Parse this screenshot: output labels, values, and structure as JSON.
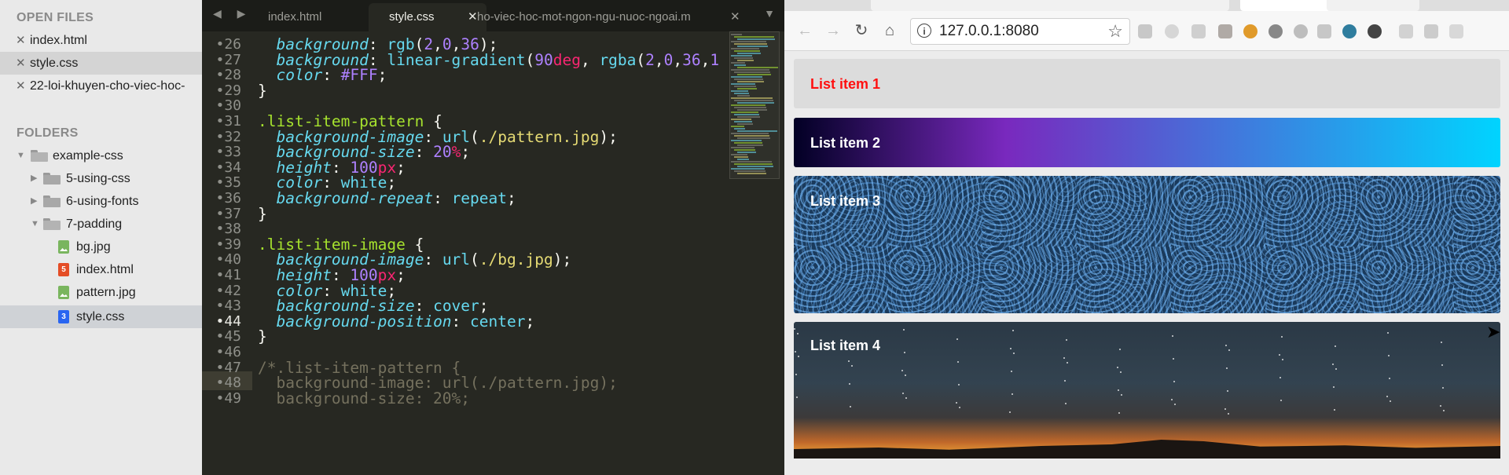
{
  "sidebar": {
    "open_files_heading": "OPEN FILES",
    "open_files": [
      {
        "name": "index.html",
        "active": false
      },
      {
        "name": "style.css",
        "active": true
      },
      {
        "name": "22-loi-khuyen-cho-viec-hoc-",
        "active": false
      }
    ],
    "folders_heading": "FOLDERS",
    "tree": [
      {
        "label": "example-css",
        "kind": "folder-open"
      },
      {
        "label": "5-using-css",
        "kind": "folder"
      },
      {
        "label": "6-using-fonts",
        "kind": "folder"
      },
      {
        "label": "7-padding",
        "kind": "folder-open"
      },
      {
        "label": "bg.jpg",
        "kind": "image"
      },
      {
        "label": "index.html",
        "kind": "html",
        "badge": "5"
      },
      {
        "label": "pattern.jpg",
        "kind": "image"
      },
      {
        "label": "style.css",
        "kind": "css",
        "badge": "3",
        "active": true
      }
    ]
  },
  "editor": {
    "tabs": [
      {
        "label": "index.html",
        "active": false
      },
      {
        "label": "style.css",
        "active": true
      },
      {
        "label": "ho-viec-hoc-mot-ngon-ngu-nuoc-ngoai.m",
        "active": false
      }
    ],
    "nav_arrows": "◀ ▶",
    "dropdown": "▼",
    "line_numbers": [
      "26",
      "27",
      "28",
      "29",
      "30",
      "31",
      "32",
      "33",
      "34",
      "35",
      "36",
      "37",
      "38",
      "39",
      "40",
      "41",
      "42",
      "43",
      "44",
      "45",
      "46",
      "47",
      "48",
      "49"
    ],
    "current_line": "44",
    "lines": [
      [
        [
          "p",
          "background"
        ],
        [
          "t",
          ": "
        ],
        [
          "v",
          "rgb"
        ],
        [
          "t",
          "("
        ],
        [
          "n",
          "2"
        ],
        [
          "t",
          ","
        ],
        [
          "n",
          "0"
        ],
        [
          "t",
          ","
        ],
        [
          "n",
          "36"
        ],
        [
          "t",
          ");"
        ]
      ],
      [
        [
          "p",
          "background"
        ],
        [
          "t",
          ": "
        ],
        [
          "v",
          "linear-gradient"
        ],
        [
          "t",
          "("
        ],
        [
          "n",
          "90"
        ],
        [
          "u",
          "deg"
        ],
        [
          "t",
          ", "
        ],
        [
          "v",
          "rgba"
        ],
        [
          "t",
          "("
        ],
        [
          "n",
          "2"
        ],
        [
          "t",
          ","
        ],
        [
          "n",
          "0"
        ],
        [
          "t",
          ","
        ],
        [
          "n",
          "36"
        ],
        [
          "t",
          ","
        ],
        [
          "n",
          "1"
        ]
      ],
      [
        [
          "p",
          "color"
        ],
        [
          "t",
          ": "
        ],
        [
          "n",
          "#FFF"
        ],
        [
          "t",
          ";"
        ]
      ],
      [
        [
          "t",
          "}"
        ]
      ],
      [],
      [
        [
          "s",
          ".list-item-pattern"
        ],
        [
          "t",
          " {"
        ]
      ],
      [
        [
          "p",
          "background-image"
        ],
        [
          "t",
          ": "
        ],
        [
          "v",
          "url"
        ],
        [
          "t",
          "("
        ],
        [
          "str",
          "./pattern.jpg"
        ],
        [
          "t",
          ");"
        ]
      ],
      [
        [
          "p",
          "background-size"
        ],
        [
          "t",
          ": "
        ],
        [
          "n",
          "20"
        ],
        [
          "u",
          "%"
        ],
        [
          "t",
          ";"
        ]
      ],
      [
        [
          "p",
          "height"
        ],
        [
          "t",
          ": "
        ],
        [
          "n",
          "100"
        ],
        [
          "u",
          "px"
        ],
        [
          "t",
          ";"
        ]
      ],
      [
        [
          "p",
          "color"
        ],
        [
          "t",
          ": "
        ],
        [
          "v",
          "white"
        ],
        [
          "t",
          ";"
        ]
      ],
      [
        [
          "p",
          "background-repeat"
        ],
        [
          "t",
          ": "
        ],
        [
          "v",
          "repeat"
        ],
        [
          "t",
          ";"
        ]
      ],
      [
        [
          "t",
          "}"
        ]
      ],
      [],
      [
        [
          "s",
          ".list-item-image"
        ],
        [
          "t",
          " {"
        ]
      ],
      [
        [
          "p",
          "background-image"
        ],
        [
          "t",
          ": "
        ],
        [
          "v",
          "url"
        ],
        [
          "t",
          "("
        ],
        [
          "str",
          "./bg.jpg"
        ],
        [
          "t",
          ");"
        ]
      ],
      [
        [
          "p",
          "height"
        ],
        [
          "t",
          ": "
        ],
        [
          "n",
          "100"
        ],
        [
          "u",
          "px"
        ],
        [
          "t",
          ";"
        ]
      ],
      [
        [
          "p",
          "color"
        ],
        [
          "t",
          ": "
        ],
        [
          "v",
          "white"
        ],
        [
          "t",
          ";"
        ]
      ],
      [
        [
          "p",
          "background-size"
        ],
        [
          "t",
          ": "
        ],
        [
          "v",
          "cover"
        ],
        [
          "t",
          ";"
        ]
      ],
      [
        [
          "p",
          "background-position"
        ],
        [
          "t",
          ": "
        ],
        [
          "v",
          "center"
        ],
        [
          "t",
          ";"
        ]
      ],
      [
        [
          "t",
          "}"
        ]
      ],
      [],
      [
        [
          "c",
          "/*.list-item-pattern {"
        ]
      ],
      [
        [
          "c",
          "  background-image: url(./pattern.jpg);"
        ]
      ],
      [
        [
          "c",
          "  background-size: 20%;"
        ]
      ]
    ],
    "indent": [
      1,
      1,
      1,
      0,
      0,
      0,
      1,
      1,
      1,
      1,
      1,
      0,
      0,
      0,
      1,
      1,
      1,
      1,
      1,
      0,
      0,
      0,
      0,
      0
    ]
  },
  "browser": {
    "tabs": [
      "",
      "",
      " ",
      "",
      " "
    ],
    "url": "127.0.0.1:8080",
    "list_items": [
      "List item 1",
      "List item 2",
      "List item 3",
      "List item 4"
    ],
    "colors": {
      "item1_text": "#ff1010",
      "gradient_start": "#020024",
      "gradient_end": "#00d4ff"
    }
  }
}
